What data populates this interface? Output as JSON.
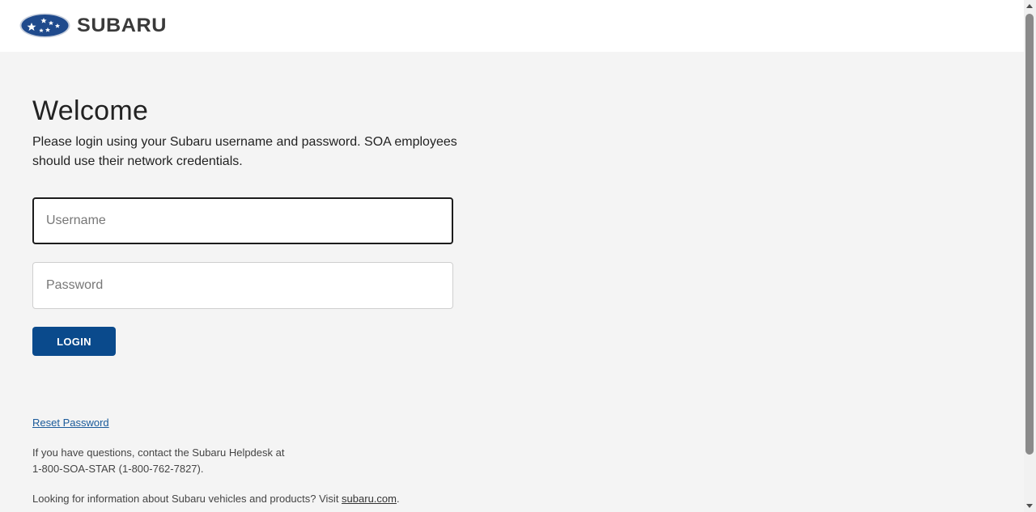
{
  "header": {
    "brand": "SUBARU",
    "logo_icon": "subaru-pleiades-emblem",
    "colors": {
      "emblem_blue": "#1f4a8c",
      "wordmark": "#3a3a3a"
    }
  },
  "login": {
    "title": "Welcome",
    "intro": "Please login using your Subaru username and password. SOA employees should use their network credentials.",
    "username": {
      "placeholder": "Username",
      "value": ""
    },
    "password": {
      "placeholder": "Password",
      "value": ""
    },
    "login_label": "LOGIN",
    "colors": {
      "button": "#0a4a8c",
      "page_background": "#f4f4f4"
    }
  },
  "footer": {
    "reset_password": "Reset Password",
    "helpdesk_line1": "If you have questions, contact the Subaru Helpdesk at",
    "helpdesk_line2": "1-800-SOA-STAR (1-800-762-7827).",
    "vehicles_prefix": "Looking for information about Subaru vehicles and products? Visit ",
    "vehicles_link": "subaru.com",
    "vehicles_suffix": "."
  }
}
